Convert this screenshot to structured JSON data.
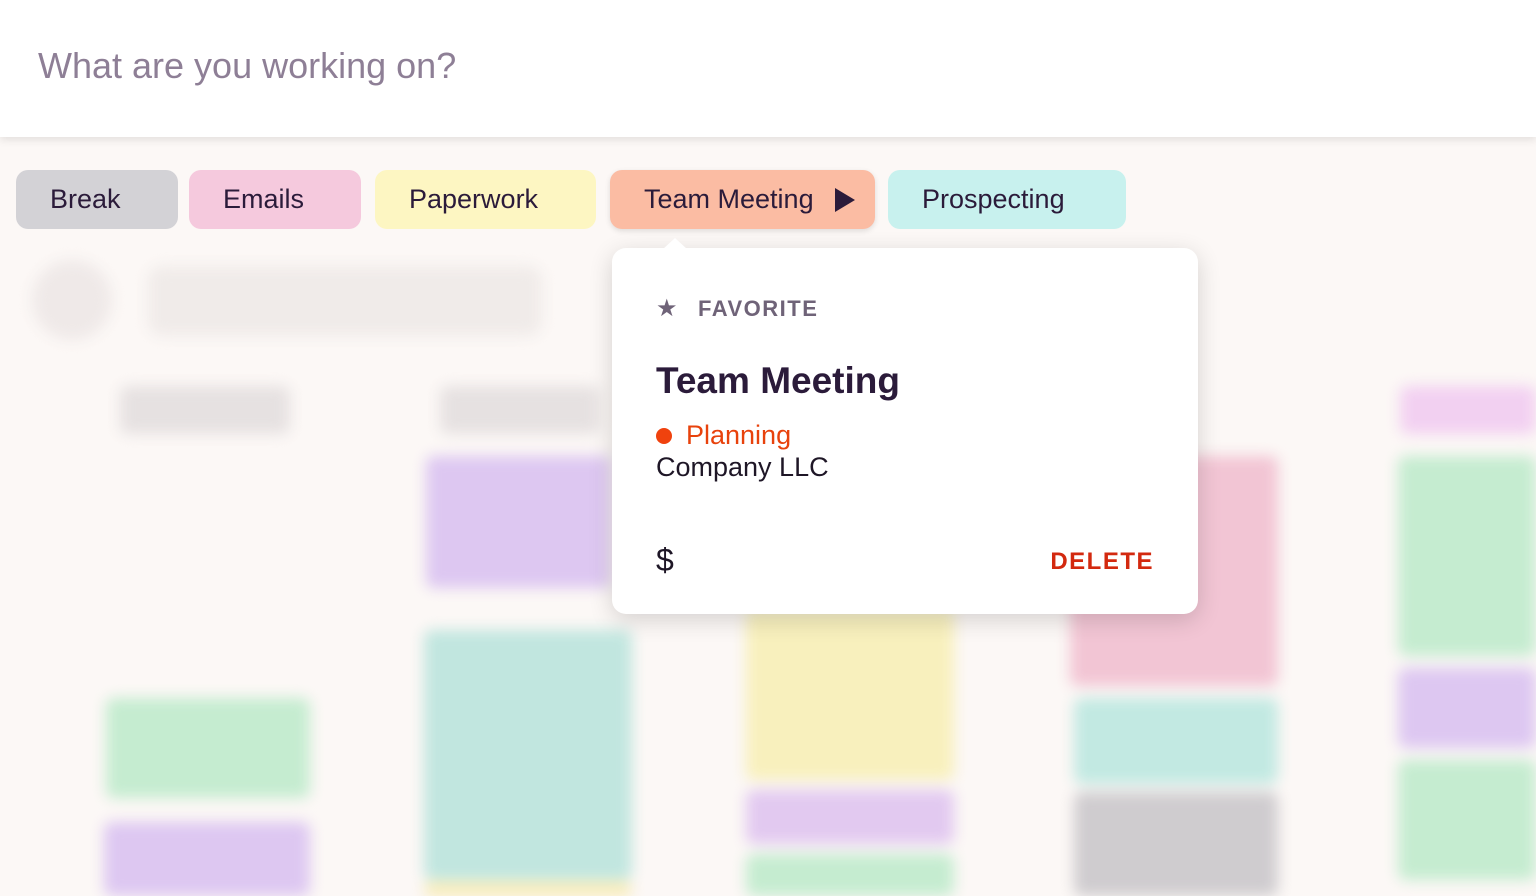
{
  "search": {
    "placeholder": "What are you working on?"
  },
  "activities": [
    {
      "label": "Break",
      "color": "#d3d2d6"
    },
    {
      "label": "Emails",
      "color": "#f5c9dd"
    },
    {
      "label": "Paperwork",
      "color": "#fdf6c2"
    },
    {
      "label": "Team Meeting",
      "color": "#fbbca3",
      "selected": true
    },
    {
      "label": "Prospecting",
      "color": "#c8f1ee"
    }
  ],
  "popover": {
    "favorite_label": "FAVORITE",
    "favorite_icon": "star-icon",
    "title": "Team Meeting",
    "project": "Planning",
    "project_color": "#f0420e",
    "client": "Company LLC",
    "billable_symbol": "$",
    "delete_label": "DELETE"
  }
}
